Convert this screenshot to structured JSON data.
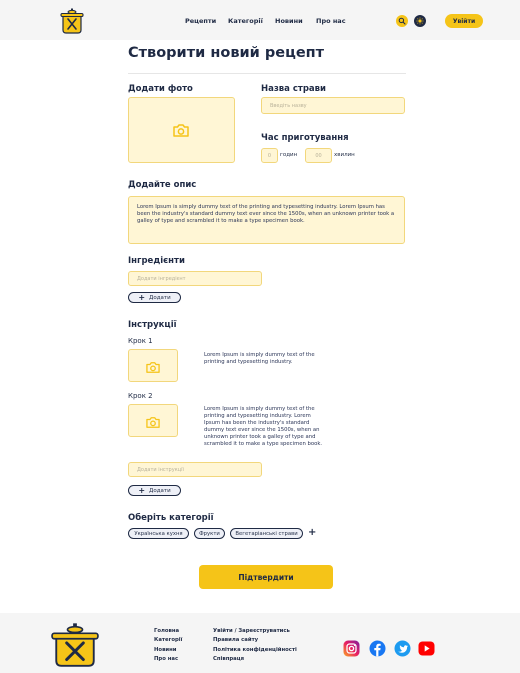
{
  "nav": {
    "items": [
      "Рецепти",
      "Категорії",
      "Новини",
      "Про нас"
    ],
    "login": "Увійти"
  },
  "page": {
    "title": "Створити новий рецепт"
  },
  "photo": {
    "label": "Додати фото"
  },
  "dish": {
    "label": "Назва страви",
    "placeholder": "Введіть назву"
  },
  "time": {
    "label": "Час приготування",
    "hours_value": "0",
    "hours_label": "годин",
    "minutes_value": "00",
    "minutes_label": "хвилин"
  },
  "description": {
    "label": "Додайте опис",
    "text": "Lorem Ipsum is simply dummy text of the printing and typesetting industry. Lorem Ipsum has been the industry's standard dummy text ever since the 1500s, when an unknown printer took a galley of type and scrambled it to make a type specimen book."
  },
  "ingredients": {
    "label": "Інгредієнти",
    "placeholder": "Додати інгредієнт",
    "add": "Додати"
  },
  "instructions": {
    "label": "Інструкції",
    "steps": [
      {
        "title": "Крок 1",
        "text": "Lorem Ipsum is simply dummy text of the printing and typesetting industry."
      },
      {
        "title": "Крок 2",
        "text": "Lorem Ipsum is simply dummy text of the printing and typesetting industry. Lorem Ipsum has been the industry's standard dummy text ever since the 1500s, when an unknown printer took a galley of type and scrambled it to make a type specimen book."
      }
    ],
    "placeholder": "Додати інструкції",
    "add": "Додати"
  },
  "categories": {
    "label": "Оберіть категорії",
    "chips": [
      "Українська кухня",
      "Фрукти",
      "Вегетаріанські страви"
    ]
  },
  "confirm": "Підтвердити",
  "footer": {
    "col1": [
      "Головна",
      "Категорії",
      "Новини",
      "Про нас"
    ],
    "col2": [
      "Увійти / Зареєструватись",
      "Правила сайту",
      "Політика конфіденційності",
      "Співпраця"
    ]
  },
  "colors": {
    "accent": "#f5c418",
    "field_bg": "#fff6d5",
    "text": "#1f2a44"
  },
  "icons": [
    "logo-pot-icon",
    "search-icon",
    "sun-icon",
    "camera-icon",
    "plus-icon",
    "instagram-icon",
    "facebook-icon",
    "twitter-icon",
    "youtube-icon"
  ]
}
